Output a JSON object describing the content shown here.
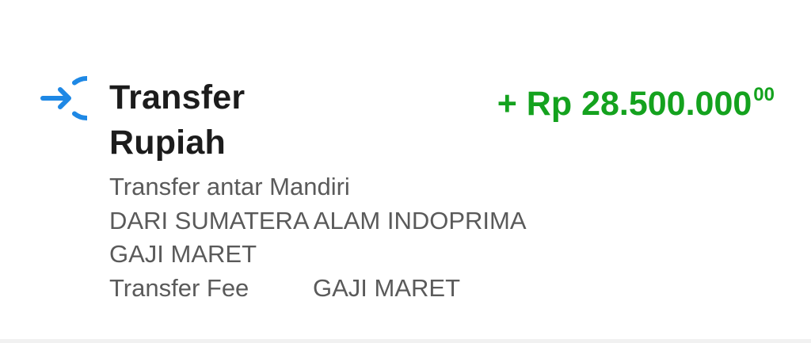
{
  "transaction": {
    "icon": "transfer-in-icon",
    "title": "Transfer Rupiah",
    "amount": {
      "prefix": "+ Rp ",
      "value": "28.500.000",
      "decimals": "00",
      "color": "#14a21e"
    },
    "details": {
      "line1": "Transfer antar Mandiri",
      "line2": "DARI SUMATERA ALAM INDOPRIMA",
      "line3": "GAJI MARET",
      "fee_label": "Transfer Fee",
      "fee_note": "GAJI MARET"
    },
    "icon_color": "#1e88e5"
  }
}
